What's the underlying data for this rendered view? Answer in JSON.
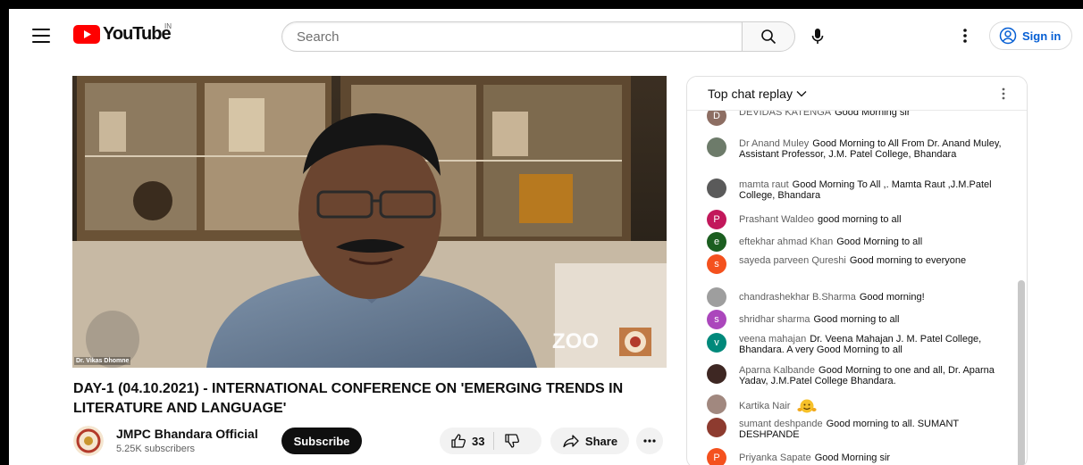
{
  "header": {
    "logo_text": "YouTube",
    "country_code": "IN",
    "search_placeholder": "Search",
    "sign_in_label": "Sign in"
  },
  "video": {
    "name_tag": "Dr. Vikas Dhomne",
    "watermark": "ZOOM",
    "title": "DAY-1 (04.10.2021) - INTERNATIONAL CONFERENCE ON 'EMERGING TRENDS IN LITERATURE AND LANGUAGE'",
    "channel_name": "JMPC Bhandara Official",
    "subscribers": "5.25K subscribers",
    "subscribe_label": "Subscribe",
    "likes": "33",
    "share_label": "Share"
  },
  "chat": {
    "header_label": "Top chat replay",
    "messages": [
      {
        "author": "DEVIDAS KATENGA",
        "text": "Good Morning sir",
        "avatar_letter": "D",
        "avatar_color": "#8d6e63"
      },
      {
        "author": "Dr Anand Muley",
        "text": "Good Morning to All From Dr. Anand Muley, Assistant Professor, J.M. Patel College, Bhandara",
        "avatar_letter": "",
        "avatar_color": "#6d7b6a"
      },
      {
        "author": "mamta raut",
        "text": "Good Morning To All ,. Mamta Raut ,J.M.Patel College, Bhandara",
        "avatar_letter": "",
        "avatar_color": "#5a5a5a"
      },
      {
        "author": "Prashant Waldeo",
        "text": "good morning to all",
        "avatar_letter": "P",
        "avatar_color": "#c2185b"
      },
      {
        "author": "eftekhar ahmad Khan",
        "text": "Good Morning to all",
        "avatar_letter": "e",
        "avatar_color": "#1b5e20"
      },
      {
        "author": "sayeda parveen Qureshi",
        "text": "Good morning to everyone",
        "avatar_letter": "s",
        "avatar_color": "#f4511e"
      },
      {
        "author": "chandrashekhar B.Sharma",
        "text": "Good morning!",
        "avatar_letter": "",
        "avatar_color": "#9e9e9e"
      },
      {
        "author": "shridhar sharma",
        "text": "Good morning to all",
        "avatar_letter": "s",
        "avatar_color": "#ab47bc"
      },
      {
        "author": "veena mahajan",
        "text": "Dr. Veena Mahajan J. M. Patel College, Bhandara. A very Good Morning to all",
        "avatar_letter": "v",
        "avatar_color": "#00897b"
      },
      {
        "author": "Aparna Kalbande",
        "text": "Good Morning to one and all, Dr. Aparna Yadav, J.M.Patel College Bhandara.",
        "avatar_letter": "",
        "avatar_color": "#3e2723"
      },
      {
        "author": "Kartika Nair",
        "text": "",
        "avatar_letter": "",
        "avatar_color": "#a1887f"
      },
      {
        "author": "sumant deshpande",
        "text": "Good morning to all. SUMANT DESHPANDE",
        "avatar_letter": "",
        "avatar_color": "#8d3b2f"
      },
      {
        "author": "Priyanka Sapate",
        "text": "Good Morning sir",
        "avatar_letter": "P",
        "avatar_color": "#f4511e"
      }
    ]
  }
}
